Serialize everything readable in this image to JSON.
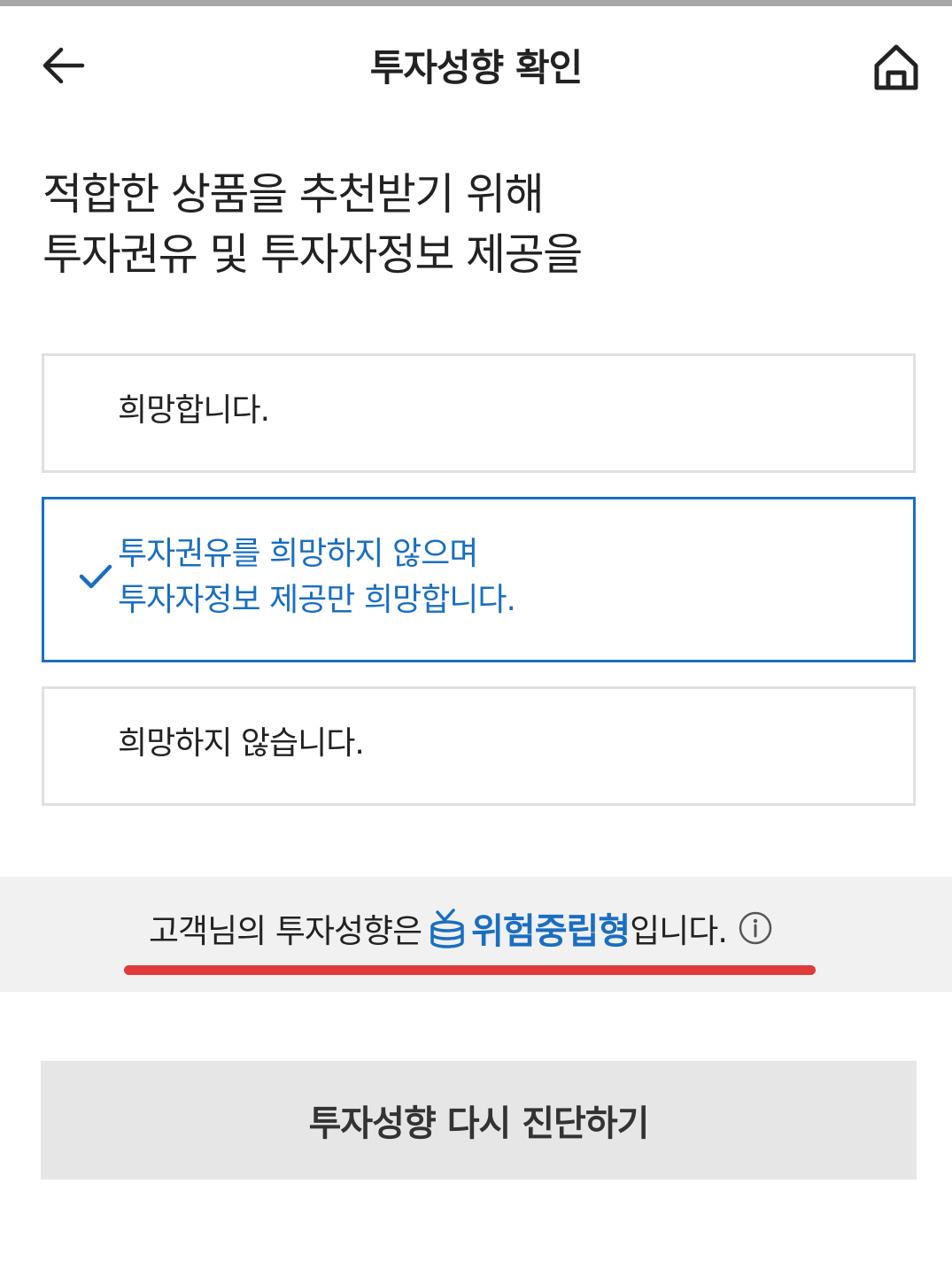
{
  "header": {
    "title": "투자성향 확인",
    "back_icon": "arrow-left-icon",
    "home_icon": "home-icon"
  },
  "question": {
    "line1": "적합한 상품을 추천받기 위해",
    "line2": "투자권유 및 투자자정보 제공을"
  },
  "options": [
    {
      "lines": [
        "희망합니다."
      ],
      "selected": false
    },
    {
      "lines": [
        "투자권유를 희망하지 않으며",
        "투자자정보 제공만 희망합니다."
      ],
      "selected": true
    },
    {
      "lines": [
        "희망하지 않습니다."
      ],
      "selected": false
    }
  ],
  "result": {
    "prefix": "고객님의 투자성향은",
    "type": "위험중립형",
    "suffix": "입니다.",
    "type_icon": "coin-stack-icon",
    "info_icon": "info-icon"
  },
  "retake_button": {
    "label": "투자성향 다시 진단하기"
  },
  "colors": {
    "accent": "#1a6ec2",
    "highlight_underline": "#e03a3a",
    "band_background": "#f1f1f1",
    "button_background": "#e6e6e6"
  }
}
